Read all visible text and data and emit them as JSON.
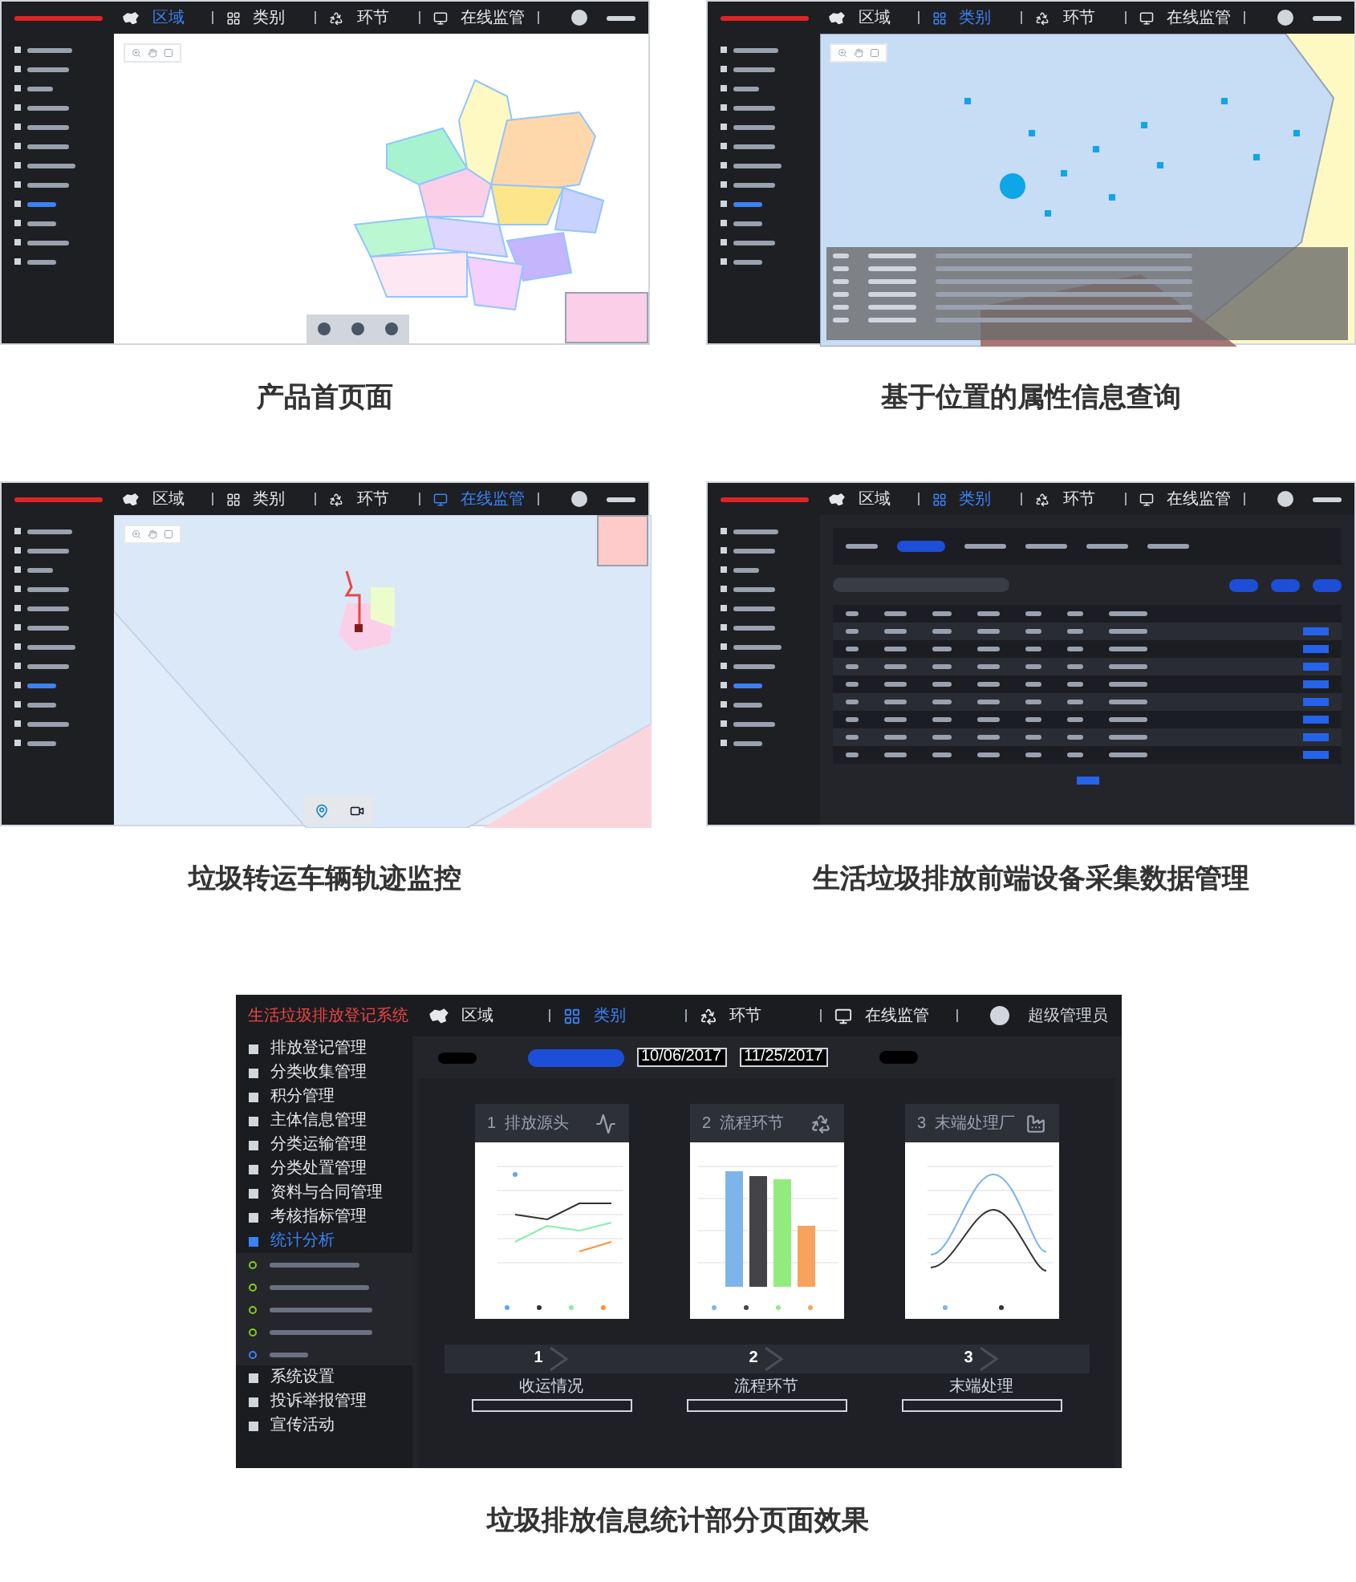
{
  "thumbnails": [
    {
      "kind": "region",
      "caption": "产品首页面",
      "nav": [
        {
          "label": "区域",
          "selected": true
        },
        {
          "label": "类别",
          "selected": false
        },
        {
          "label": "环节",
          "selected": false
        },
        {
          "label": "在线监管",
          "selected": false
        }
      ]
    },
    {
      "kind": "points",
      "caption": "基于位置的属性信息查询",
      "nav": [
        {
          "label": "区域",
          "selected": false
        },
        {
          "label": "类别",
          "selected": true
        },
        {
          "label": "环节",
          "selected": false
        },
        {
          "label": "在线监管",
          "selected": false
        }
      ]
    },
    {
      "kind": "track",
      "caption": "垃圾转运车辆轨迹监控",
      "nav": [
        {
          "label": "区域",
          "selected": false
        },
        {
          "label": "类别",
          "selected": false
        },
        {
          "label": "环节",
          "selected": false
        },
        {
          "label": "在线监管",
          "selected": true
        }
      ]
    },
    {
      "kind": "table",
      "caption": "生活垃圾排放前端设备采集数据管理",
      "nav": [
        {
          "label": "区域",
          "selected": false
        },
        {
          "label": "类别",
          "selected": true
        },
        {
          "label": "环节",
          "selected": false
        },
        {
          "label": "在线监管",
          "selected": false
        }
      ]
    }
  ],
  "showcase": {
    "app_title": "生活垃圾排放登记系统",
    "user": "超级管理员",
    "nav": [
      {
        "label": "区域",
        "selected": false
      },
      {
        "label": "类别",
        "selected": true
      },
      {
        "label": "环节",
        "selected": false
      },
      {
        "label": "在线监管",
        "selected": false
      }
    ],
    "sidebar": [
      {
        "label": "排放登记管理",
        "selected": false,
        "expanded": false
      },
      {
        "label": "分类收集管理",
        "selected": false,
        "expanded": false
      },
      {
        "label": "积分管理",
        "selected": false,
        "expanded": false
      },
      {
        "label": "主体信息管理",
        "selected": false,
        "expanded": false
      },
      {
        "label": "分类运输管理",
        "selected": false,
        "expanded": false
      },
      {
        "label": "分类处置管理",
        "selected": false,
        "expanded": false
      },
      {
        "label": "资料与合同管理",
        "selected": false,
        "expanded": false
      },
      {
        "label": "考核指标管理",
        "selected": false,
        "expanded": false
      },
      {
        "label": "统计分析",
        "selected": true,
        "expanded": true
      },
      {
        "label": "系统设置",
        "selected": false,
        "expanded": false
      },
      {
        "label": "投诉举报管理",
        "selected": false,
        "expanded": false
      },
      {
        "label": "宣传活动",
        "selected": false,
        "expanded": false
      }
    ],
    "date_from": "10/06/2017",
    "date_to": "11/25/2017",
    "cards": [
      {
        "number": "1",
        "title": "排放源头",
        "kind": "line"
      },
      {
        "number": "2",
        "title": "流程环节",
        "kind": "bar"
      },
      {
        "number": "3",
        "title": "末端处理厂",
        "kind": "curve"
      }
    ],
    "steps": [
      "1",
      "2",
      "3"
    ],
    "sections": [
      "收运情况",
      "流程环节",
      "末端处理"
    ],
    "caption": "垃圾排放信息统计部分页面效果"
  }
}
